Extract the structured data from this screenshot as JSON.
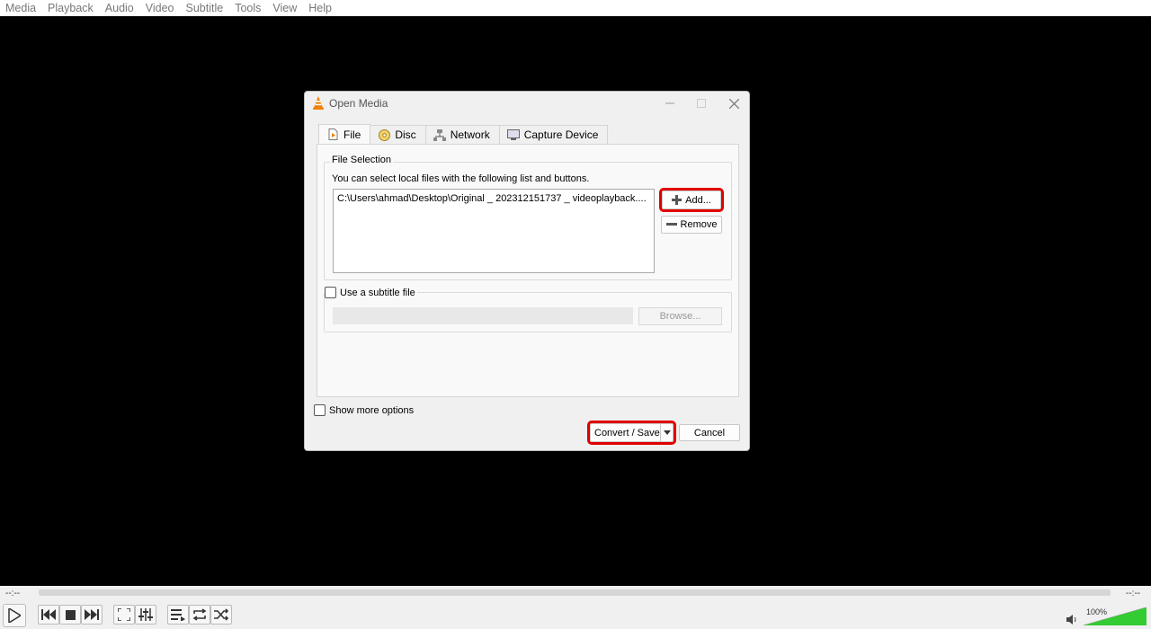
{
  "menubar": {
    "items": [
      "Media",
      "Playback",
      "Audio",
      "Video",
      "Subtitle",
      "Tools",
      "View",
      "Help"
    ]
  },
  "dialog": {
    "title": "Open Media",
    "tabs": [
      {
        "label": "File",
        "icon": "file-icon"
      },
      {
        "label": "Disc",
        "icon": "disc-icon"
      },
      {
        "label": "Network",
        "icon": "network-icon"
      },
      {
        "label": "Capture Device",
        "icon": "capture-device-icon"
      }
    ],
    "file_selection": {
      "legend": "File Selection",
      "description": "You can select local files with the following list and buttons.",
      "files": [
        "C:\\Users\\ahmad\\Desktop\\Original _ 202312151737 _ videoplayback...."
      ],
      "add_label": "Add...",
      "remove_label": "Remove"
    },
    "subtitle": {
      "checkbox_label": "Use a subtitle file",
      "browse_label": "Browse..."
    },
    "show_more_label": "Show more options",
    "convert_label": "Convert / Save",
    "cancel_label": "Cancel"
  },
  "player": {
    "time_elapsed": "--:--",
    "time_total": "--:--",
    "volume": "100%"
  },
  "colors": {
    "highlight": "#e00000",
    "volume": "#33cc33",
    "vlc_orange": "#f08000"
  }
}
